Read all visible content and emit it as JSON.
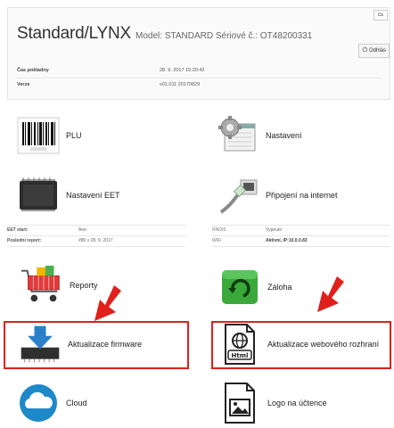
{
  "header": {
    "title": "Standard/LYNX",
    "subtitle": "Model: STANDARD Sériové č.: OT48200331",
    "lang_button": "cs",
    "logout_label": "Odhlás",
    "rows": [
      {
        "label": "Čas pokladny",
        "value": "28. 9. 2017 15:20:42"
      },
      {
        "label": "Verze",
        "value": "v01.011 20170829"
      }
    ]
  },
  "tiles": {
    "plu": "PLU",
    "settings": "Nastavení",
    "eet_settings": "Nastavení EET",
    "internet": "Připojení na internet",
    "reports": "Reporty",
    "backup": "Záloha",
    "firmware_update": "Aktualizace firmware",
    "web_update": "Aktualizace webového rozhraní",
    "cloud": "Cloud",
    "receipt_logo": "Logo na účtence"
  },
  "status": {
    "eet_start_label": "EET start:",
    "eet_start_value": "Ano",
    "last_report_label": "Poslední report:",
    "last_report_value": "#80 v 28. 9. 2017",
    "rndis_label": "RNDIS",
    "rndis_value": "Vypnuto",
    "wifi_label": "WiFi",
    "wifi_value": "Aktivní, IP:10.0.0.83"
  },
  "colors": {
    "highlight": "#e0201c",
    "arrow": "#e0201c",
    "cloud": "#1e88c8",
    "backup": "#3aa83a",
    "download": "#2c7fc9"
  }
}
